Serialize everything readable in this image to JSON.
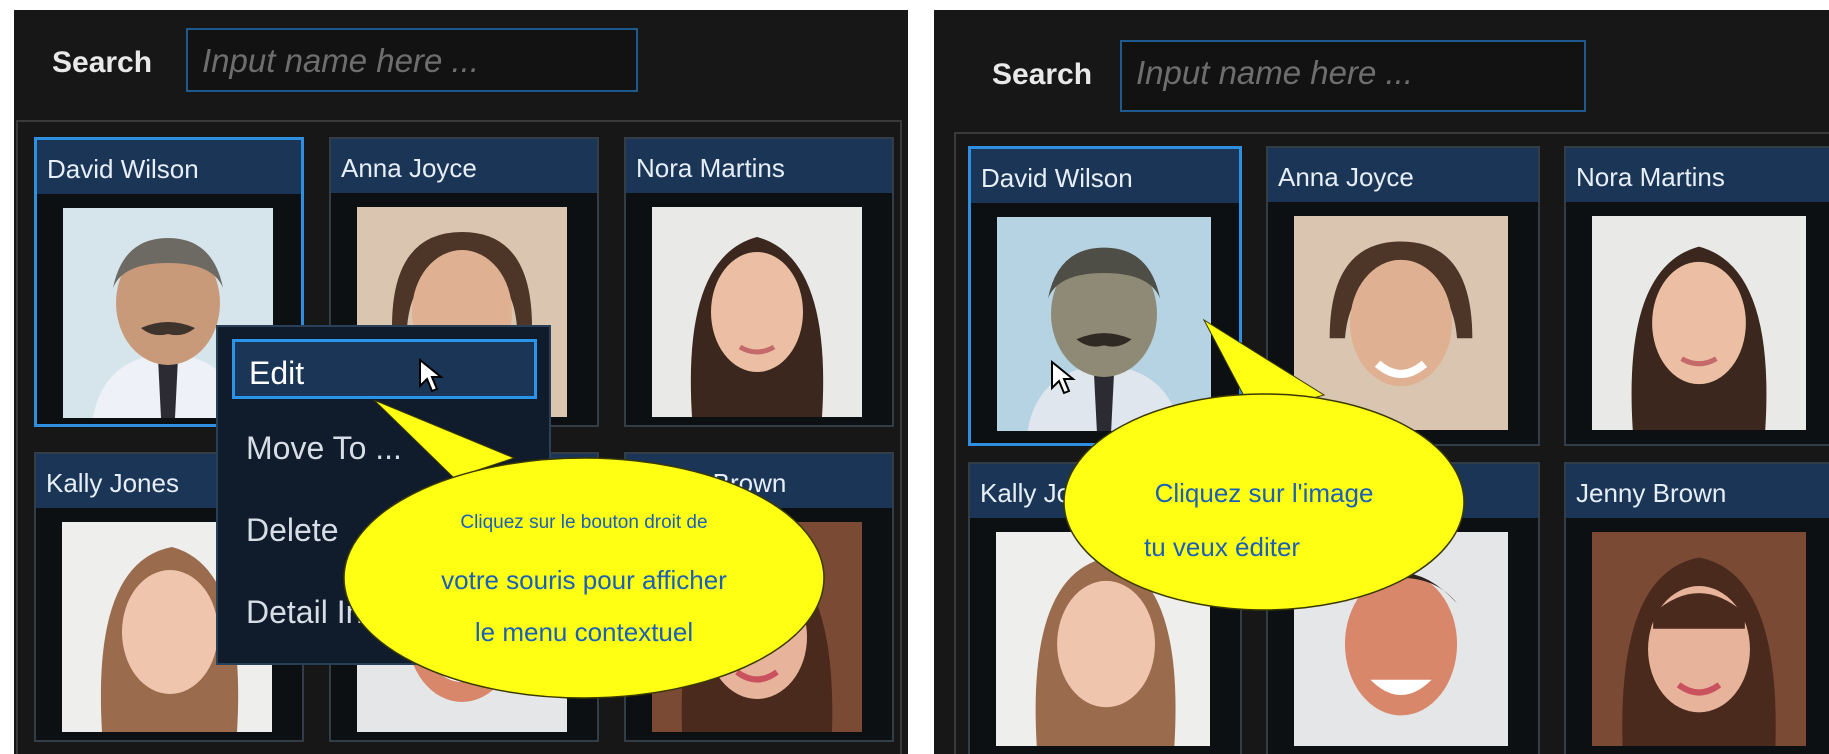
{
  "search": {
    "label": "Search",
    "placeholder": "Input name here ..."
  },
  "contacts": [
    {
      "name": "David Wilson",
      "photo": "middle-aged man with mustache, grey hair, tie"
    },
    {
      "name": "Anna Joyce",
      "photo": "woman with short brown hair"
    },
    {
      "name": "Nora Martins",
      "photo": "young woman with dark hair"
    },
    {
      "name": "Kally Jones",
      "photo": "young woman with light brown hair"
    },
    {
      "name": "",
      "photo": "smiling man"
    },
    {
      "name": "Jenny Brown",
      "photo": "smiling woman with bangs"
    }
  ],
  "context_menu": {
    "items": [
      "Edit",
      "Move To ...",
      "Delete",
      "Detail Info"
    ]
  },
  "callouts": {
    "left_line1": "Cliquez sur le bouton droit de",
    "left_line2": "votre souris pour afficher",
    "left_line3": "le menu contextuel",
    "right_line1": "Cliquez sur l'image",
    "right_line2": "tu veux éditer"
  },
  "colors": {
    "panel_bg": "#171717",
    "card_header": "#1b3556",
    "selection_border": "#2e8fe0",
    "bubble_fill": "#ffff14",
    "bubble_text": "#1b5fb8"
  }
}
